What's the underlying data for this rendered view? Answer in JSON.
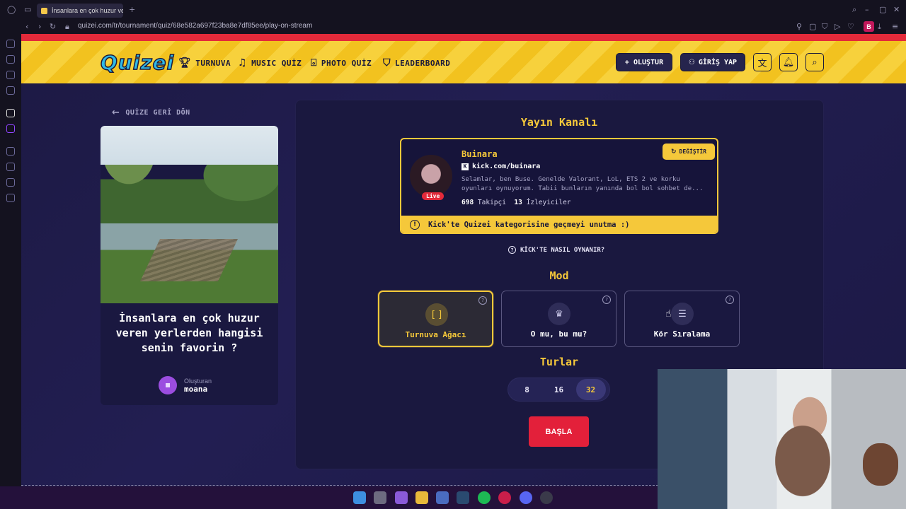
{
  "browser": {
    "tab_title": "İnsanlara en çok huzur ve",
    "url": "quizei.com/tr/tournament/quiz/68e582a697f23ba8e7df85ee/play-on-stream",
    "profile_initial": "B"
  },
  "header": {
    "logo": "Quizei",
    "nav": [
      {
        "label": "TURNUVA",
        "icon": "trophy-icon"
      },
      {
        "label": "MUSIC QUİZ",
        "icon": "music-note-icon"
      },
      {
        "label": "PHOTO QUİZ",
        "icon": "camera-icon"
      },
      {
        "label": "LEADERBOARD",
        "icon": "medal-icon"
      }
    ],
    "create_label": "+ OLUŞTUR",
    "login_label": "GİRİŞ YAP"
  },
  "back_label": "QUİZE GERİ DÖN",
  "quiz": {
    "title": "İnsanlara en çok huzur veren yerlerden hangisi senin favorin ?",
    "creator_label": "Oluşturan",
    "creator_name": "moana"
  },
  "stream": {
    "title": "Yayın Kanalı",
    "channel_name": "Buinara",
    "channel_link": "kick.com/buinara",
    "description": "Selamlar, ben Buse. Genelde Valorant, LoL, ETS 2 ve korku oyunları oynuyorum. Tabii bunların yanında bol bol sohbet de...",
    "live_label": "Live",
    "followers_count": "698",
    "followers_label": "Takipçi",
    "viewers_count": "13",
    "viewers_label": "İzleyiciler",
    "change_label": "DEĞİŞTİR",
    "notice": "Kick'te Quizei kategorisine geçmeyi unutma :)",
    "howto_label": "KİCK'TE NASIL OYNANIR?"
  },
  "mode": {
    "title": "Mod",
    "options": [
      {
        "label": "Turnuva Ağacı",
        "icon": "bracket-icon",
        "selected": true
      },
      {
        "label": "O mu, bu mu?",
        "icon": "crown-icon",
        "selected": false
      },
      {
        "label": "Kör Sıralama",
        "icon": "list-icon",
        "selected": false
      }
    ]
  },
  "rounds": {
    "title": "Turlar",
    "options": [
      "8",
      "16",
      "32"
    ],
    "selected": "32"
  },
  "start_label": "BAŞLA",
  "colors": {
    "accent": "#f5c83a",
    "start": "#e3203a",
    "header_stripe": "#f2c21f"
  }
}
